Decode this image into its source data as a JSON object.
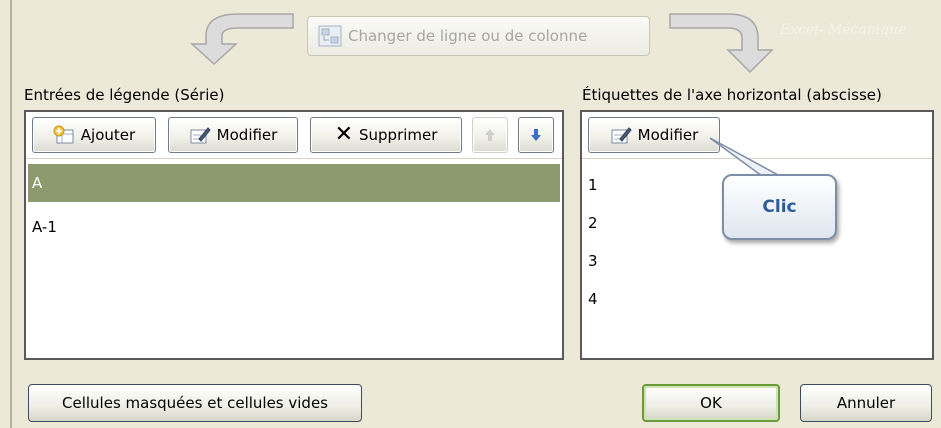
{
  "top": {
    "switch_row_col": "Changer de ligne ou de colonne",
    "watermark": "Excel- Mécanique"
  },
  "legend": {
    "label": "Entrées de légende (Série)",
    "add_button": "Ajouter",
    "edit_button": "Modifier",
    "delete_button": "Supprimer",
    "series": [
      "A",
      "A-1"
    ]
  },
  "axis": {
    "label": "Étiquettes de l'axe horizontal (abscisse)",
    "edit_button": "Modifier",
    "items": [
      "1",
      "2",
      "3",
      "4"
    ],
    "callout": "Clic"
  },
  "footer": {
    "hidden_cells_button": "Cellules masquées et cellules vides",
    "ok_button": "OK",
    "cancel_button": "Annuler"
  },
  "colors": {
    "selected_row": "#8c9a6e",
    "callout_text": "#2c5c97",
    "dialog_bg": "#ece9d8"
  }
}
